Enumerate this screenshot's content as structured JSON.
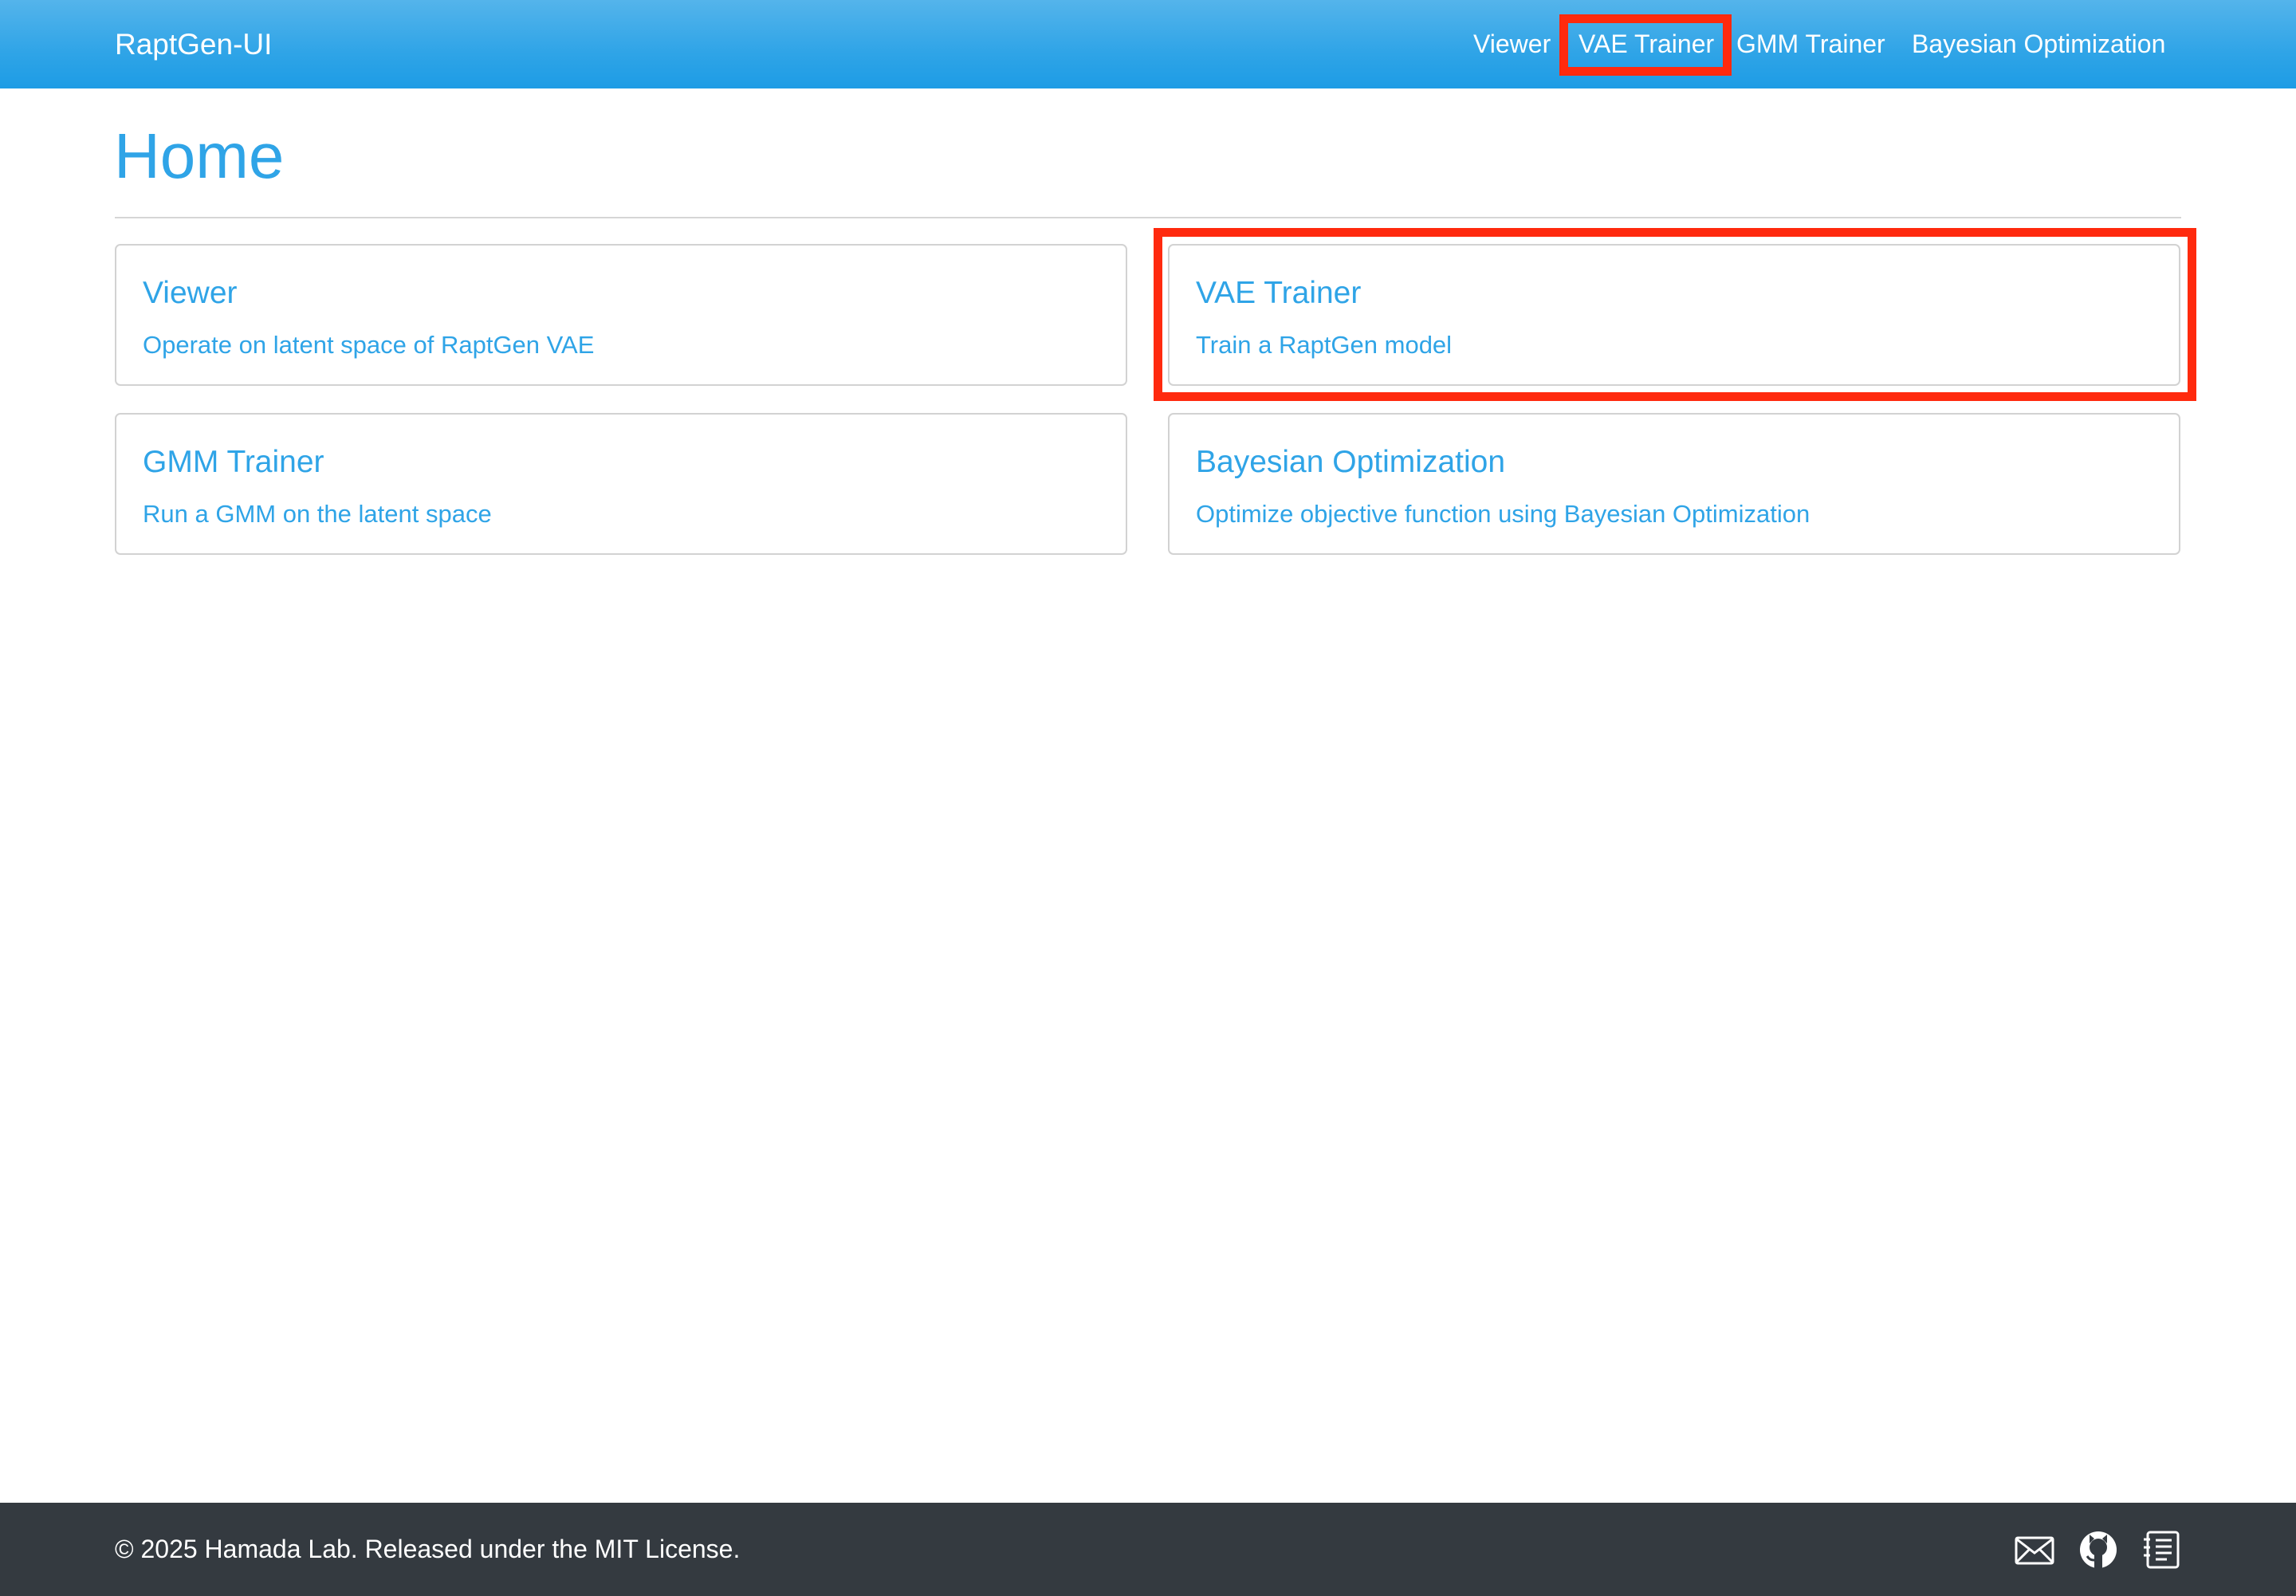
{
  "navbar": {
    "brand": "RaptGen-UI",
    "links": [
      {
        "label": "Viewer"
      },
      {
        "label": "VAE Trainer"
      },
      {
        "label": "GMM Trainer"
      },
      {
        "label": "Bayesian Optimization"
      }
    ]
  },
  "page": {
    "title": "Home"
  },
  "cards": [
    {
      "title": "Viewer",
      "description": "Operate on latent space of RaptGen VAE"
    },
    {
      "title": "VAE Trainer",
      "description": "Train a RaptGen model"
    },
    {
      "title": "GMM Trainer",
      "description": "Run a GMM on the latent space"
    },
    {
      "title": "Bayesian Optimization",
      "description": "Optimize objective function using Bayesian Optimization"
    }
  ],
  "footer": {
    "copyright": "© 2025 Hamada Lab. Released under the MIT License.",
    "icons": [
      "mail-icon",
      "github-icon",
      "docs-icon"
    ]
  },
  "colors": {
    "primary": "#2fa4e7",
    "highlight": "#ff2a0e",
    "footer_bg": "#343a40"
  }
}
